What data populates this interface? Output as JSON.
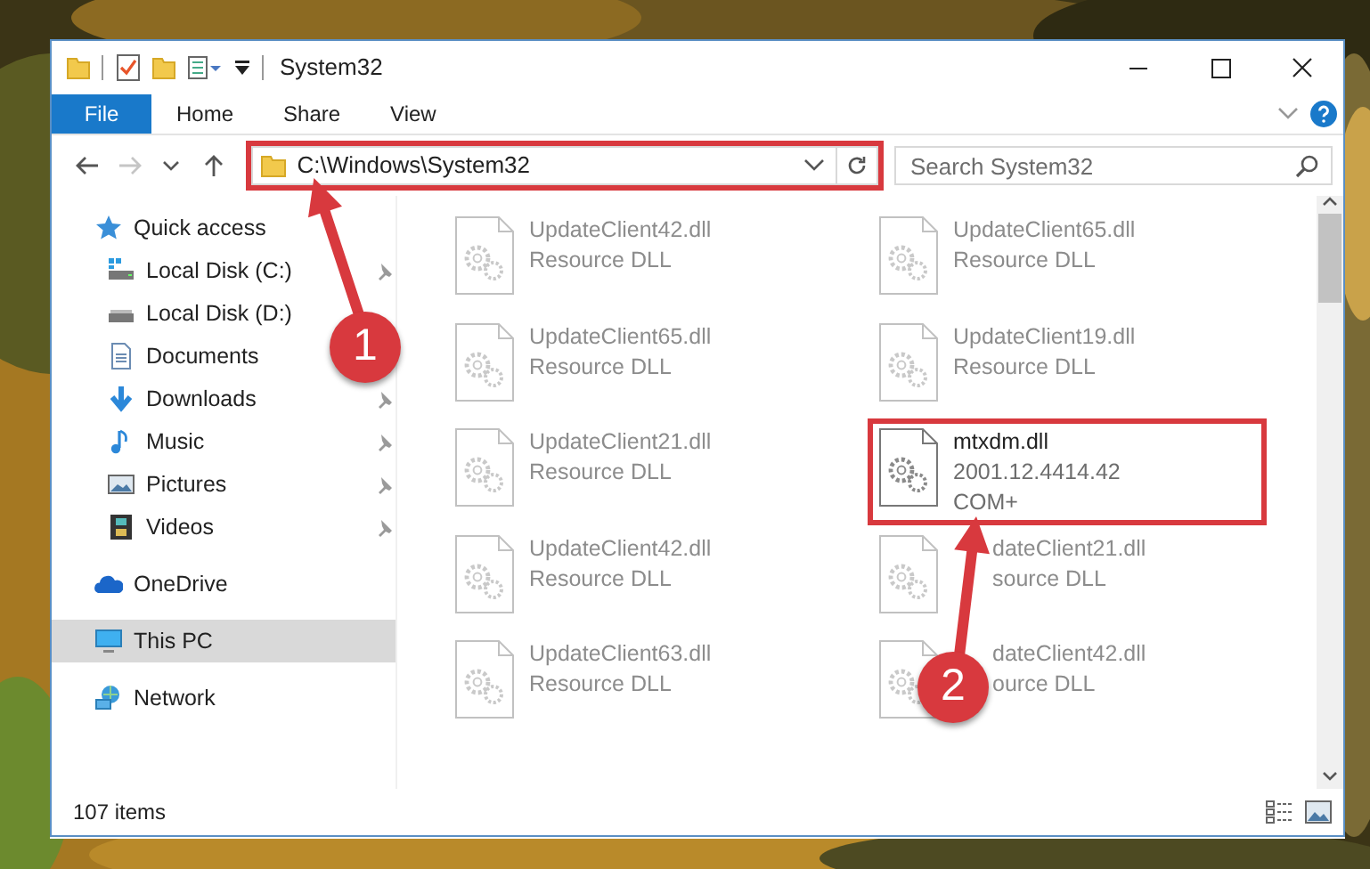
{
  "window": {
    "title": "System32"
  },
  "ribbon_tabs": [
    {
      "label": "File",
      "kind": "file"
    },
    {
      "label": "Home",
      "kind": "tab"
    },
    {
      "label": "Share",
      "kind": "tab"
    },
    {
      "label": "View",
      "kind": "tab"
    }
  ],
  "address_bar": {
    "path": "C:\\Windows\\System32",
    "highlighted": true
  },
  "search": {
    "placeholder": "Search System32"
  },
  "navigation": [
    {
      "label": "Quick access",
      "kind": "star",
      "selected": false,
      "children": [
        {
          "label": "Local Disk (C:)",
          "kind": "system-drive",
          "pinned": true,
          "selected": false
        },
        {
          "label": "Local Disk (D:)",
          "kind": "drive",
          "selected": false
        },
        {
          "label": "Documents",
          "kind": "document",
          "selected": false
        },
        {
          "label": "Downloads",
          "kind": "download",
          "pinned": true,
          "selected": false
        },
        {
          "label": "Music",
          "kind": "music",
          "pinned": true,
          "selected": false
        },
        {
          "label": "Pictures",
          "kind": "pictures",
          "pinned": true,
          "selected": false
        },
        {
          "label": "Videos",
          "kind": "videos",
          "pinned": true,
          "selected": false
        }
      ]
    },
    {
      "label": "OneDrive",
      "kind": "cloud",
      "selected": false
    },
    {
      "label": "This PC",
      "kind": "computer",
      "selected": true
    },
    {
      "label": "Network",
      "kind": "network",
      "selected": false
    }
  ],
  "files": [
    {
      "name": "UpdateClient42.dll",
      "details": [
        "Resource DLL"
      ],
      "dimmed": true,
      "highlighted": false
    },
    {
      "name": "UpdateClient65.dll",
      "details": [
        "Resource DLL"
      ],
      "dimmed": true,
      "highlighted": false
    },
    {
      "name": "UpdateClient65.dll",
      "details": [
        "Resource DLL"
      ],
      "dimmed": true,
      "highlighted": false
    },
    {
      "name": "UpdateClient19.dll",
      "details": [
        "Resource DLL"
      ],
      "dimmed": true,
      "highlighted": false
    },
    {
      "name": "UpdateClient21.dll",
      "details": [
        "Resource DLL"
      ],
      "dimmed": true,
      "highlighted": false
    },
    {
      "name": "mtxdm.dll",
      "details": [
        "2001.12.4414.42",
        "COM+"
      ],
      "dimmed": false,
      "highlighted": true
    },
    {
      "name": "UpdateClient42.dll",
      "details": [
        "Resource DLL"
      ],
      "dimmed": true,
      "highlighted": false
    },
    {
      "name": "dateClient21.dll",
      "details": [
        "source DLL"
      ],
      "dimmed": true,
      "highlighted": false,
      "covered": true
    },
    {
      "name": "UpdateClient63.dll",
      "details": [
        "Resource DLL"
      ],
      "dimmed": true,
      "highlighted": false
    },
    {
      "name": "dateClient42.dll",
      "details": [
        "ource DLL"
      ],
      "dimmed": true,
      "highlighted": false,
      "covered": true
    }
  ],
  "status_bar": {
    "count": "107 items"
  },
  "callouts": [
    {
      "number": "1"
    },
    {
      "number": "2"
    }
  ]
}
